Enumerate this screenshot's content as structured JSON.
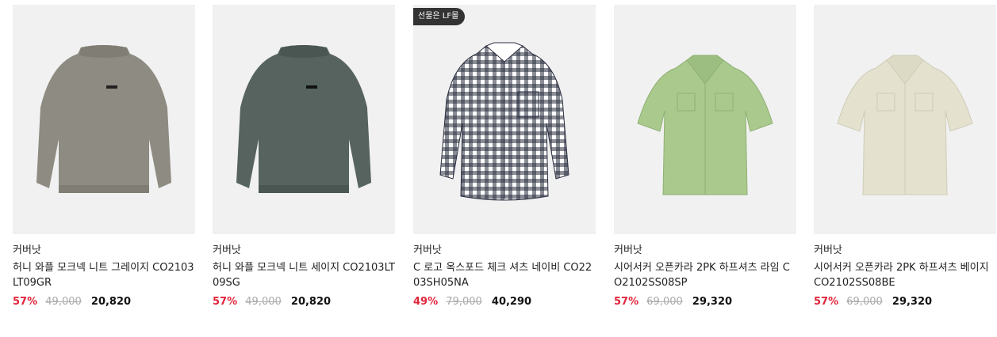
{
  "products": [
    {
      "brand": "커버낫",
      "title": "허니 와플 모크넥 니트 그레이지 CO2103LT09GR",
      "discount": "57%",
      "original_price": "49,000",
      "sale_price": "20,820",
      "badge": "",
      "color": "#8d8b82"
    },
    {
      "brand": "커버낫",
      "title": "허니 와플 모크넥 니트 세이지 CO2103LT09SG",
      "discount": "57%",
      "original_price": "49,000",
      "sale_price": "20,820",
      "badge": "",
      "color": "#56635f"
    },
    {
      "brand": "커버낫",
      "title": "C 로고 옥스포드 체크 셔츠 네이비 CO2203SH05NA",
      "discount": "49%",
      "original_price": "79,000",
      "sale_price": "40,290",
      "badge": "선물은 LF몰",
      "color": "#1e2230"
    },
    {
      "brand": "커버낫",
      "title": "시어서커 오픈카라 2PK 하프셔츠 라임 CO2102SS08SP",
      "discount": "57%",
      "original_price": "69,000",
      "sale_price": "29,320",
      "badge": "",
      "color": "#a9c98d"
    },
    {
      "brand": "커버낫",
      "title": "시어서커 오픈카라 2PK 하프셔츠 베이지 CO2102SS08BE",
      "discount": "57%",
      "original_price": "69,000",
      "sale_price": "29,320",
      "badge": "",
      "color": "#e4e1ce"
    }
  ]
}
